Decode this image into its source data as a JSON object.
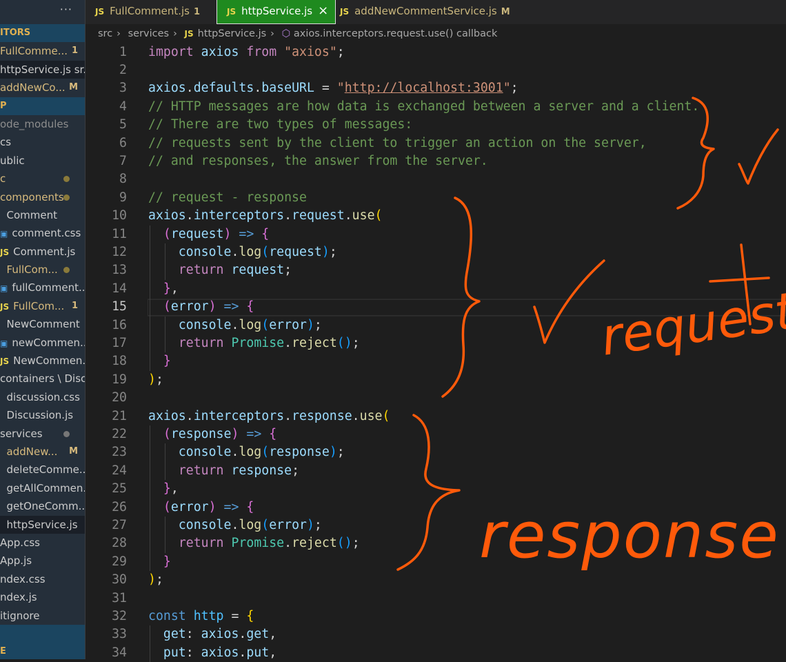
{
  "sidebar": {
    "more_label": "···",
    "rows": [
      {
        "text": "ITORS",
        "type": "section"
      },
      {
        "text": "FullComme...",
        "badge": "1",
        "color": "yl"
      },
      {
        "text": "httpService.js sr...",
        "sel": true
      },
      {
        "text": "addNewCo...",
        "badge": "M",
        "color": "yl"
      },
      {
        "text": "P",
        "type": "section"
      },
      {
        "text": "ode_modules",
        "color": "gr"
      },
      {
        "text": "cs"
      },
      {
        "text": "ublic"
      },
      {
        "text": "c",
        "color": "yl",
        "dot": true
      },
      {
        "text": "components",
        "color": "yl",
        "dot": true
      },
      {
        "text": "  Comment"
      },
      {
        "text": "comment.css",
        "icon": "css"
      },
      {
        "text": "Comment.js",
        "icon": "js"
      },
      {
        "text": "  FullCom...",
        "color": "yl",
        "dot": true
      },
      {
        "text": "fullComment....",
        "icon": "css"
      },
      {
        "text": "FullCom...",
        "icon": "js",
        "badge": "1",
        "color": "yl"
      },
      {
        "text": "  NewComment"
      },
      {
        "text": "newCommen...",
        "icon": "css"
      },
      {
        "text": "NewCommen...",
        "icon": "js"
      },
      {
        "text": "containers \\ Disc..."
      },
      {
        "text": "  discussion.css"
      },
      {
        "text": "  Discussion.js"
      },
      {
        "text": "services",
        "dot": true,
        "dotgray": true
      },
      {
        "text": "  addNew...",
        "badge": "M",
        "color": "yl"
      },
      {
        "text": "  deleteComme..."
      },
      {
        "text": "  getAllCommen..."
      },
      {
        "text": "  getOneComm..."
      },
      {
        "text": "  httpService.js",
        "sel": true
      },
      {
        "text": "App.css"
      },
      {
        "text": "App.js"
      },
      {
        "text": "ndex.css"
      },
      {
        "text": "ndex.js"
      },
      {
        "text": "itignore"
      },
      {
        "text": "",
        "type": "section"
      },
      {
        "text": "E",
        "type": "section"
      }
    ]
  },
  "tabs": [
    {
      "icon": "JS",
      "label": "FullComment.js",
      "badge": "1"
    },
    {
      "icon": "JS",
      "label": "httpService.js",
      "close": "×",
      "active": true
    },
    {
      "icon": "JS",
      "label": "addNewCommentService.js",
      "badge": "M"
    }
  ],
  "breadcrumb": [
    "src",
    "services",
    "httpService.js",
    "axios.interceptors.request.use() callback"
  ],
  "breadcrumb_icon": "JS",
  "editor": {
    "current_line": 15,
    "lines": [
      [
        [
          "import",
          "kw"
        ],
        [
          " "
        ],
        [
          "axios",
          "v"
        ],
        [
          " "
        ],
        [
          "from",
          "kw"
        ],
        [
          " "
        ],
        [
          "\"axios\"",
          "s"
        ],
        [
          ";",
          "p"
        ]
      ],
      [],
      [
        [
          "axios",
          "v"
        ],
        [
          ".",
          "p"
        ],
        [
          "defaults",
          "v"
        ],
        [
          ".",
          "p"
        ],
        [
          "baseURL",
          "v"
        ],
        [
          " = ",
          "p"
        ],
        [
          "\"",
          "s"
        ],
        [
          "http://localhost:3001",
          "u"
        ],
        [
          "\"",
          "s"
        ],
        [
          ";",
          "p"
        ]
      ],
      [
        [
          "// HTTP messages are how data is exchanged between a server and a client.",
          "c"
        ]
      ],
      [
        [
          "// There are two types of messages:",
          "c"
        ]
      ],
      [
        [
          "// requests sent by the client to trigger an action on the server,",
          "c"
        ]
      ],
      [
        [
          "// and responses, the answer from the server.",
          "c"
        ]
      ],
      [],
      [
        [
          "// request - response",
          "c"
        ]
      ],
      [
        [
          "axios",
          "v"
        ],
        [
          ".",
          "p"
        ],
        [
          "interceptors",
          "v"
        ],
        [
          ".",
          "p"
        ],
        [
          "request",
          "v"
        ],
        [
          ".",
          "p"
        ],
        [
          "use",
          "f"
        ],
        [
          "(",
          "b1"
        ]
      ],
      [
        [
          "  "
        ],
        [
          "(",
          "b2"
        ],
        [
          "request",
          "v"
        ],
        [
          ")",
          "b2"
        ],
        [
          " "
        ],
        [
          "=>",
          "k"
        ],
        [
          " "
        ],
        [
          "{",
          "b2"
        ]
      ],
      [
        [
          "    console",
          "v"
        ],
        [
          ".",
          "p"
        ],
        [
          "log",
          "f"
        ],
        [
          "(",
          "b3"
        ],
        [
          "request",
          "v"
        ],
        [
          ")",
          "b3"
        ],
        [
          ";",
          "p"
        ]
      ],
      [
        [
          "    "
        ],
        [
          "return",
          "kw"
        ],
        [
          " "
        ],
        [
          "request",
          "v"
        ],
        [
          ";",
          "p"
        ]
      ],
      [
        [
          "  "
        ],
        [
          "}",
          "b2"
        ],
        [
          ",",
          "p"
        ]
      ],
      [
        [
          "  "
        ],
        [
          "(",
          "b2"
        ],
        [
          "error",
          "v"
        ],
        [
          ")",
          "b2"
        ],
        [
          " "
        ],
        [
          "=>",
          "k"
        ],
        [
          " "
        ],
        [
          "{",
          "b2"
        ]
      ],
      [
        [
          "    console",
          "v"
        ],
        [
          ".",
          "p"
        ],
        [
          "log",
          "f"
        ],
        [
          "(",
          "b3"
        ],
        [
          "error",
          "v"
        ],
        [
          ")",
          "b3"
        ],
        [
          ";",
          "p"
        ]
      ],
      [
        [
          "    "
        ],
        [
          "return",
          "kw"
        ],
        [
          " "
        ],
        [
          "Promise",
          "t"
        ],
        [
          ".",
          "p"
        ],
        [
          "reject",
          "f"
        ],
        [
          "(",
          "b3"
        ],
        [
          ")",
          "b3"
        ],
        [
          ";",
          "p"
        ]
      ],
      [
        [
          "  "
        ],
        [
          "}",
          "b2"
        ]
      ],
      [
        [
          ")",
          "b1"
        ],
        [
          ";",
          "p"
        ]
      ],
      [],
      [
        [
          "axios",
          "v"
        ],
        [
          ".",
          "p"
        ],
        [
          "interceptors",
          "v"
        ],
        [
          ".",
          "p"
        ],
        [
          "response",
          "v"
        ],
        [
          ".",
          "p"
        ],
        [
          "use",
          "f"
        ],
        [
          "(",
          "b1"
        ]
      ],
      [
        [
          "  "
        ],
        [
          "(",
          "b2"
        ],
        [
          "response",
          "v"
        ],
        [
          ")",
          "b2"
        ],
        [
          " "
        ],
        [
          "=>",
          "k"
        ],
        [
          " "
        ],
        [
          "{",
          "b2"
        ]
      ],
      [
        [
          "    console",
          "v"
        ],
        [
          ".",
          "p"
        ],
        [
          "log",
          "f"
        ],
        [
          "(",
          "b3"
        ],
        [
          "response",
          "v"
        ],
        [
          ")",
          "b3"
        ],
        [
          ";",
          "p"
        ]
      ],
      [
        [
          "    "
        ],
        [
          "return",
          "kw"
        ],
        [
          " "
        ],
        [
          "response",
          "v"
        ],
        [
          ";",
          "p"
        ]
      ],
      [
        [
          "  "
        ],
        [
          "}",
          "b2"
        ],
        [
          ",",
          "p"
        ]
      ],
      [
        [
          "  "
        ],
        [
          "(",
          "b2"
        ],
        [
          "error",
          "v"
        ],
        [
          ")",
          "b2"
        ],
        [
          " "
        ],
        [
          "=>",
          "k"
        ],
        [
          " "
        ],
        [
          "{",
          "b2"
        ]
      ],
      [
        [
          "    console",
          "v"
        ],
        [
          ".",
          "p"
        ],
        [
          "log",
          "f"
        ],
        [
          "(",
          "b3"
        ],
        [
          "error",
          "v"
        ],
        [
          ")",
          "b3"
        ],
        [
          ";",
          "p"
        ]
      ],
      [
        [
          "    "
        ],
        [
          "return",
          "kw"
        ],
        [
          " "
        ],
        [
          "Promise",
          "t"
        ],
        [
          ".",
          "p"
        ],
        [
          "reject",
          "f"
        ],
        [
          "(",
          "b3"
        ],
        [
          ")",
          "b3"
        ],
        [
          ";",
          "p"
        ]
      ],
      [
        [
          "  "
        ],
        [
          "}",
          "b2"
        ]
      ],
      [
        [
          ")",
          "b1"
        ],
        [
          ";",
          "p"
        ]
      ],
      [],
      [
        [
          "const",
          "k"
        ],
        [
          " "
        ],
        [
          "http",
          "cn"
        ],
        [
          " = ",
          "p"
        ],
        [
          "{",
          "b1"
        ]
      ],
      [
        [
          "  get",
          "v"
        ],
        [
          ": ",
          "p"
        ],
        [
          "axios",
          "v"
        ],
        [
          ".",
          "p"
        ],
        [
          "get",
          "v"
        ],
        [
          ",",
          "p"
        ]
      ],
      [
        [
          "  put",
          "v"
        ],
        [
          ": ",
          "p"
        ],
        [
          "axios",
          "v"
        ],
        [
          ".",
          "p"
        ],
        [
          "put",
          "v"
        ],
        [
          ",",
          "p"
        ]
      ]
    ]
  },
  "annotations": {
    "request_label": "request",
    "response_label": "response",
    "color": "#ff5a0a"
  }
}
